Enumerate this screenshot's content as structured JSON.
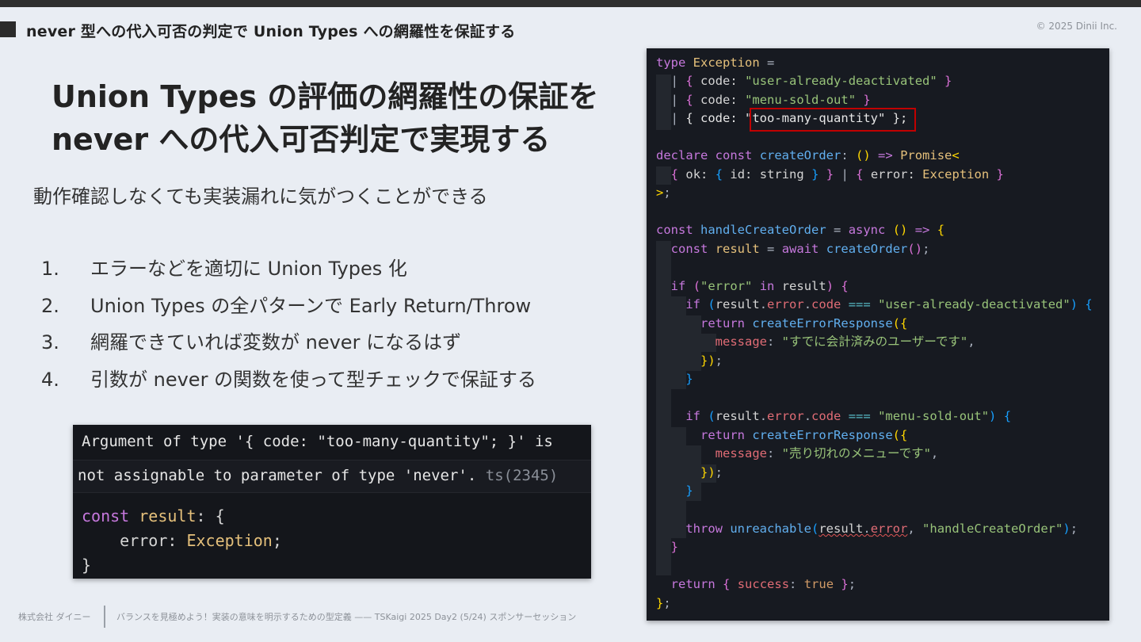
{
  "header": {
    "section": "never 型への代入可否の判定で Union Types への網羅性を保証する",
    "copyright": "© 2025 Dinii Inc."
  },
  "slide": {
    "title_line1": "Union Types の評価の網羅性の保証を",
    "title_line2": "never への代入可否判定で実現する",
    "subtitle": "動作確認しなくても実装漏れに気がつくことができる",
    "steps": [
      {
        "num": "1.",
        "text": "エラーなどを適切に Union Types 化"
      },
      {
        "num": "2.",
        "text": "Union Types の全パターンで Early Return/Throw"
      },
      {
        "num": "3.",
        "text": "網羅できていれば変数が never になるはず"
      },
      {
        "num": "4.",
        "text": "引数が never の関数を使って型チェックで保証する"
      }
    ]
  },
  "error_panel": {
    "line1": "Argument of type '{ code: \"too-many-quantity\"; }' is",
    "line2": "not assignable to parameter of type 'never'.",
    "error_code": "ts(2345)",
    "code_kw": "const",
    "code_var": "result",
    "code_sep": ": {",
    "code_prop": "    error: ",
    "code_type": "Exception",
    "code_semi": ";",
    "code_close": "}"
  },
  "code_panel": {
    "highlighted_line": "{ code: \"too-many-quantity\" };"
  },
  "footer": {
    "company": "株式会社 ダイニー",
    "talk": "バランスを見極めよう！実装の意味を明示するための型定義 —— TSKaigi 2025 Day2 (5/24) スポンサーセッション"
  },
  "colors": {
    "background": "#e9edf3",
    "code_bg": "#171a21",
    "highlight_border": "#c00000"
  }
}
